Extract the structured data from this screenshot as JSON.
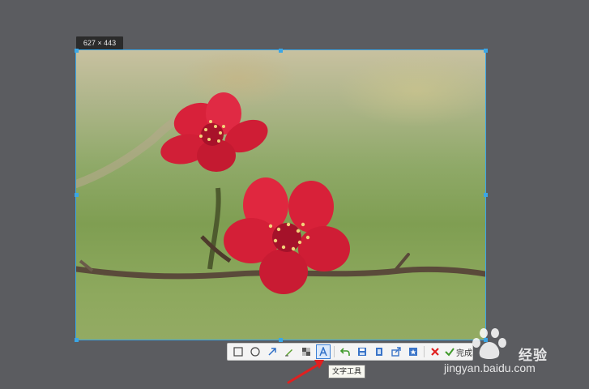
{
  "selection": {
    "size_label": "627 × 443"
  },
  "toolbar": {
    "tools": [
      {
        "icon": "rectangle-icon"
      },
      {
        "icon": "ellipse-icon"
      },
      {
        "icon": "arrow-icon"
      },
      {
        "icon": "pen-icon"
      },
      {
        "icon": "mosaic-icon"
      },
      {
        "icon": "text-tool-icon",
        "active": true
      },
      {
        "icon": "undo-icon"
      },
      {
        "icon": "save-icon"
      },
      {
        "icon": "copy-icon"
      },
      {
        "icon": "share-icon"
      },
      {
        "icon": "pin-icon"
      },
      {
        "icon": "cancel-icon"
      },
      {
        "icon": "confirm-icon"
      }
    ],
    "done_label": "完成",
    "tooltip": "文字工具"
  },
  "watermark": {
    "brand": "经验",
    "url": "jingyan.baidu.com"
  },
  "colors": {
    "background": "#5b5c60",
    "selection_border": "#3aa6e6",
    "active_tool": "#3a7fd6",
    "annotation_arrow": "#e02020"
  }
}
